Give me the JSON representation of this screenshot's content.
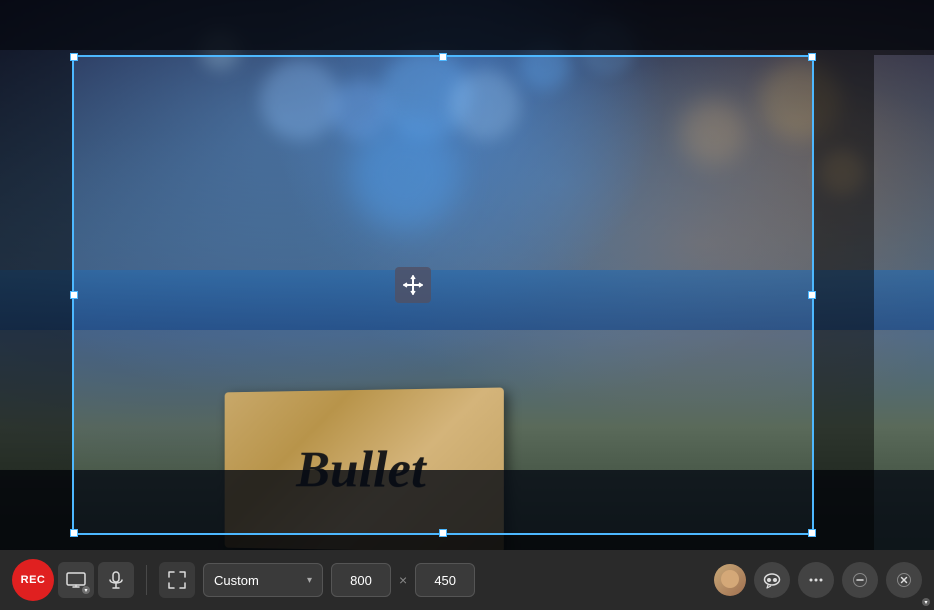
{
  "background": {
    "description": "Blurry bookstore/vinyl records background with bokeh lights"
  },
  "crop": {
    "box_label": "crop selection area",
    "handle_label": "resize handle"
  },
  "toolbar": {
    "rec_label": "REC",
    "screen_label": "screen capture button",
    "mic_label": "microphone button",
    "expand_label": "expand button",
    "resolution_label": "Custom",
    "width_value": "800",
    "height_value": "450",
    "x_separator": "×",
    "avatar_label": "user avatar",
    "chat_label": "chat/comments button",
    "more_label": "more options button",
    "minimize_label": "minimize button",
    "close_label": "close button"
  },
  "move_cursor": {
    "symbol": "⊕"
  }
}
